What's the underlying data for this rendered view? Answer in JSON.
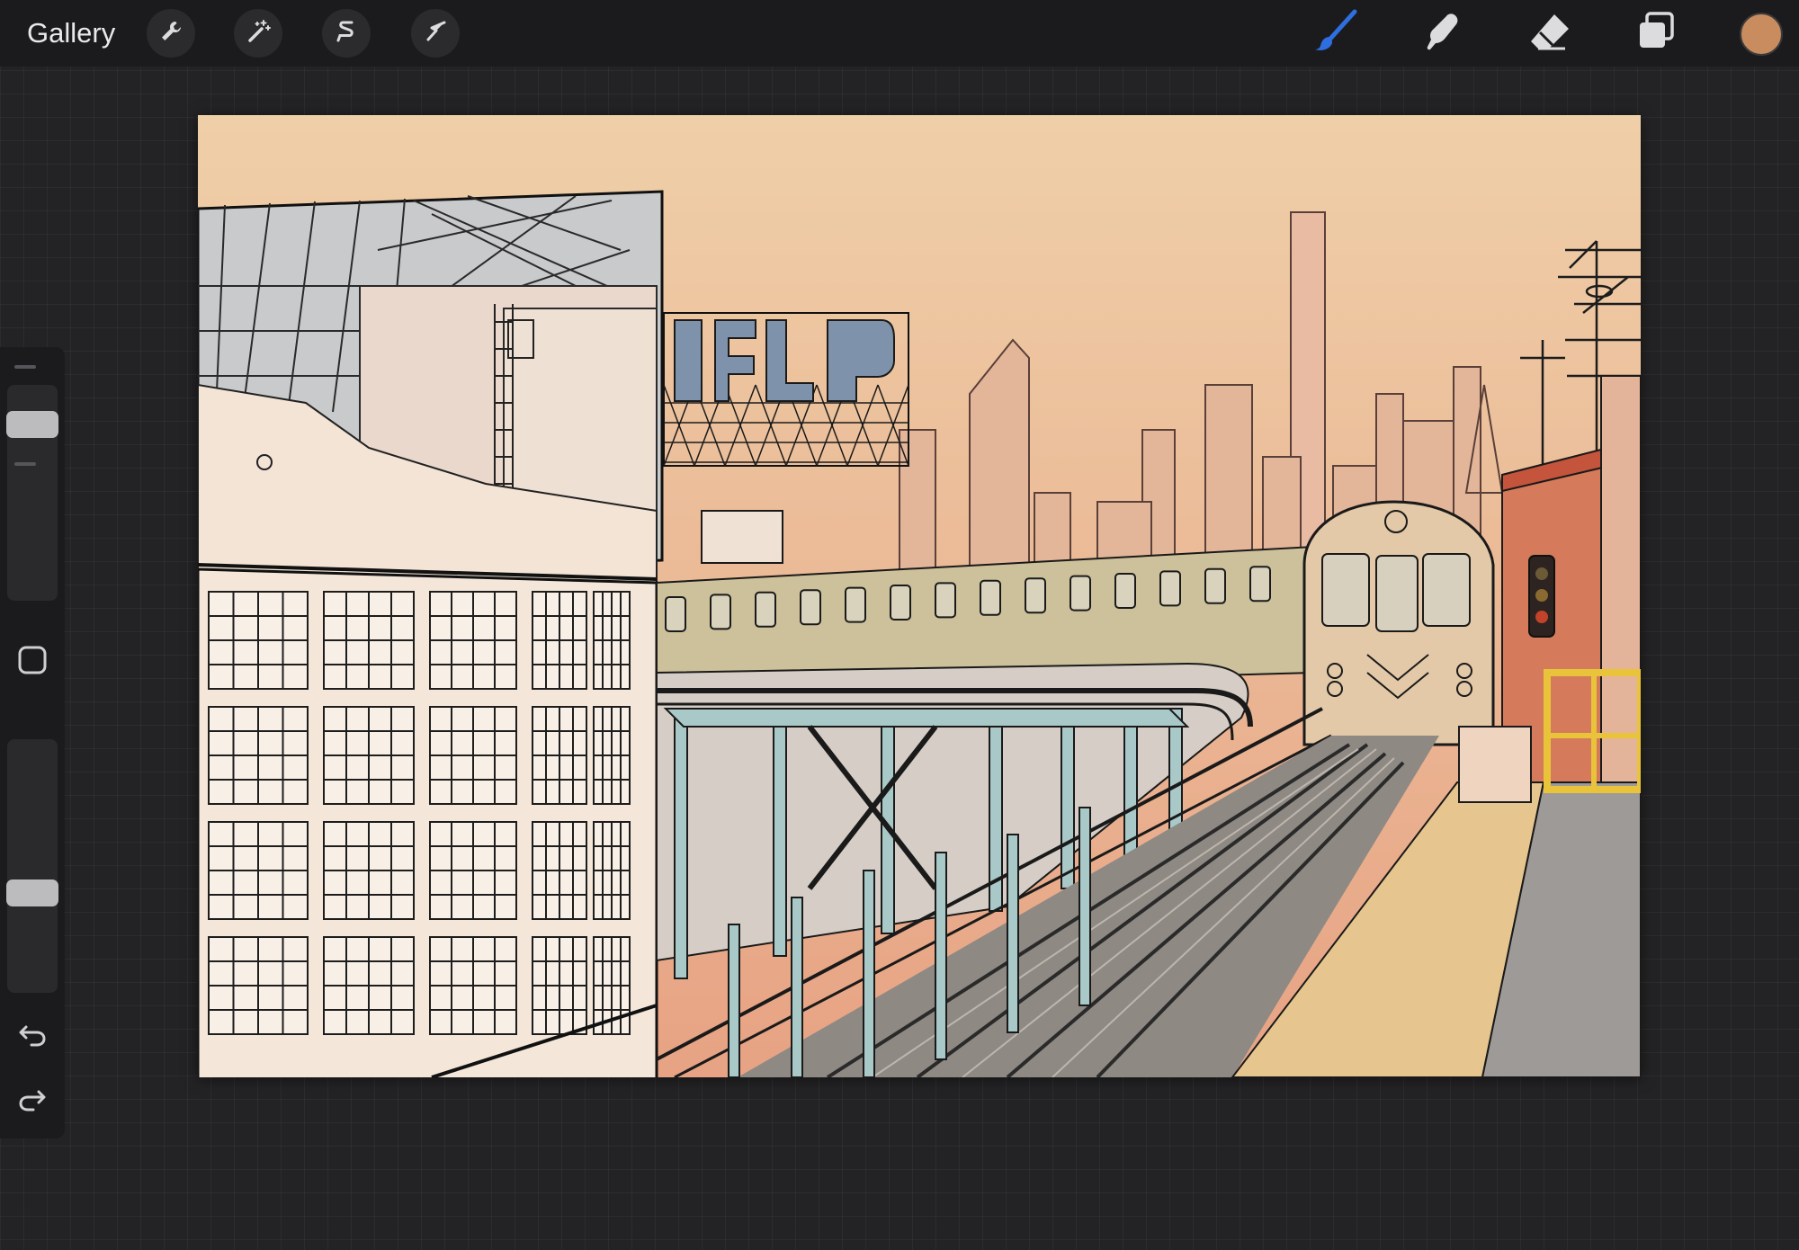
{
  "topbar": {
    "gallery_label": "Gallery",
    "left_tools": [
      {
        "name": "actions",
        "icon": "wrench-icon"
      },
      {
        "name": "adjustments",
        "icon": "magic-wand-icon"
      },
      {
        "name": "selection",
        "icon": "selection-s-icon"
      },
      {
        "name": "transform",
        "icon": "arrow-cursor-icon"
      }
    ],
    "right_tools": [
      {
        "name": "brush",
        "icon": "brush-icon",
        "active": true
      },
      {
        "name": "smudge",
        "icon": "smudge-finger-icon",
        "active": false
      },
      {
        "name": "eraser",
        "icon": "eraser-icon",
        "active": false
      },
      {
        "name": "layers",
        "icon": "layers-icon",
        "active": false
      }
    ],
    "current_color": "#c98c5e"
  },
  "sidebar": {
    "brush_size_level": 0.14,
    "opacity_level": 0.62,
    "modify_button_icon": "square-icon",
    "undo_icon": "undo-arrow-icon",
    "redo_icon": "redo-arrow-icon"
  },
  "colors": {
    "app_background": "#232325",
    "toolbar": "#1b1b1d",
    "active_tool_accent": "#2f6ee0",
    "sky_top": "#efcfa8",
    "sky_bottom": "#e7a384",
    "structure_steel": "#a9c8c8",
    "platform": "#e6c68e"
  },
  "canvas": {
    "artwork": "illustration-elevated-train-city-skyline"
  }
}
